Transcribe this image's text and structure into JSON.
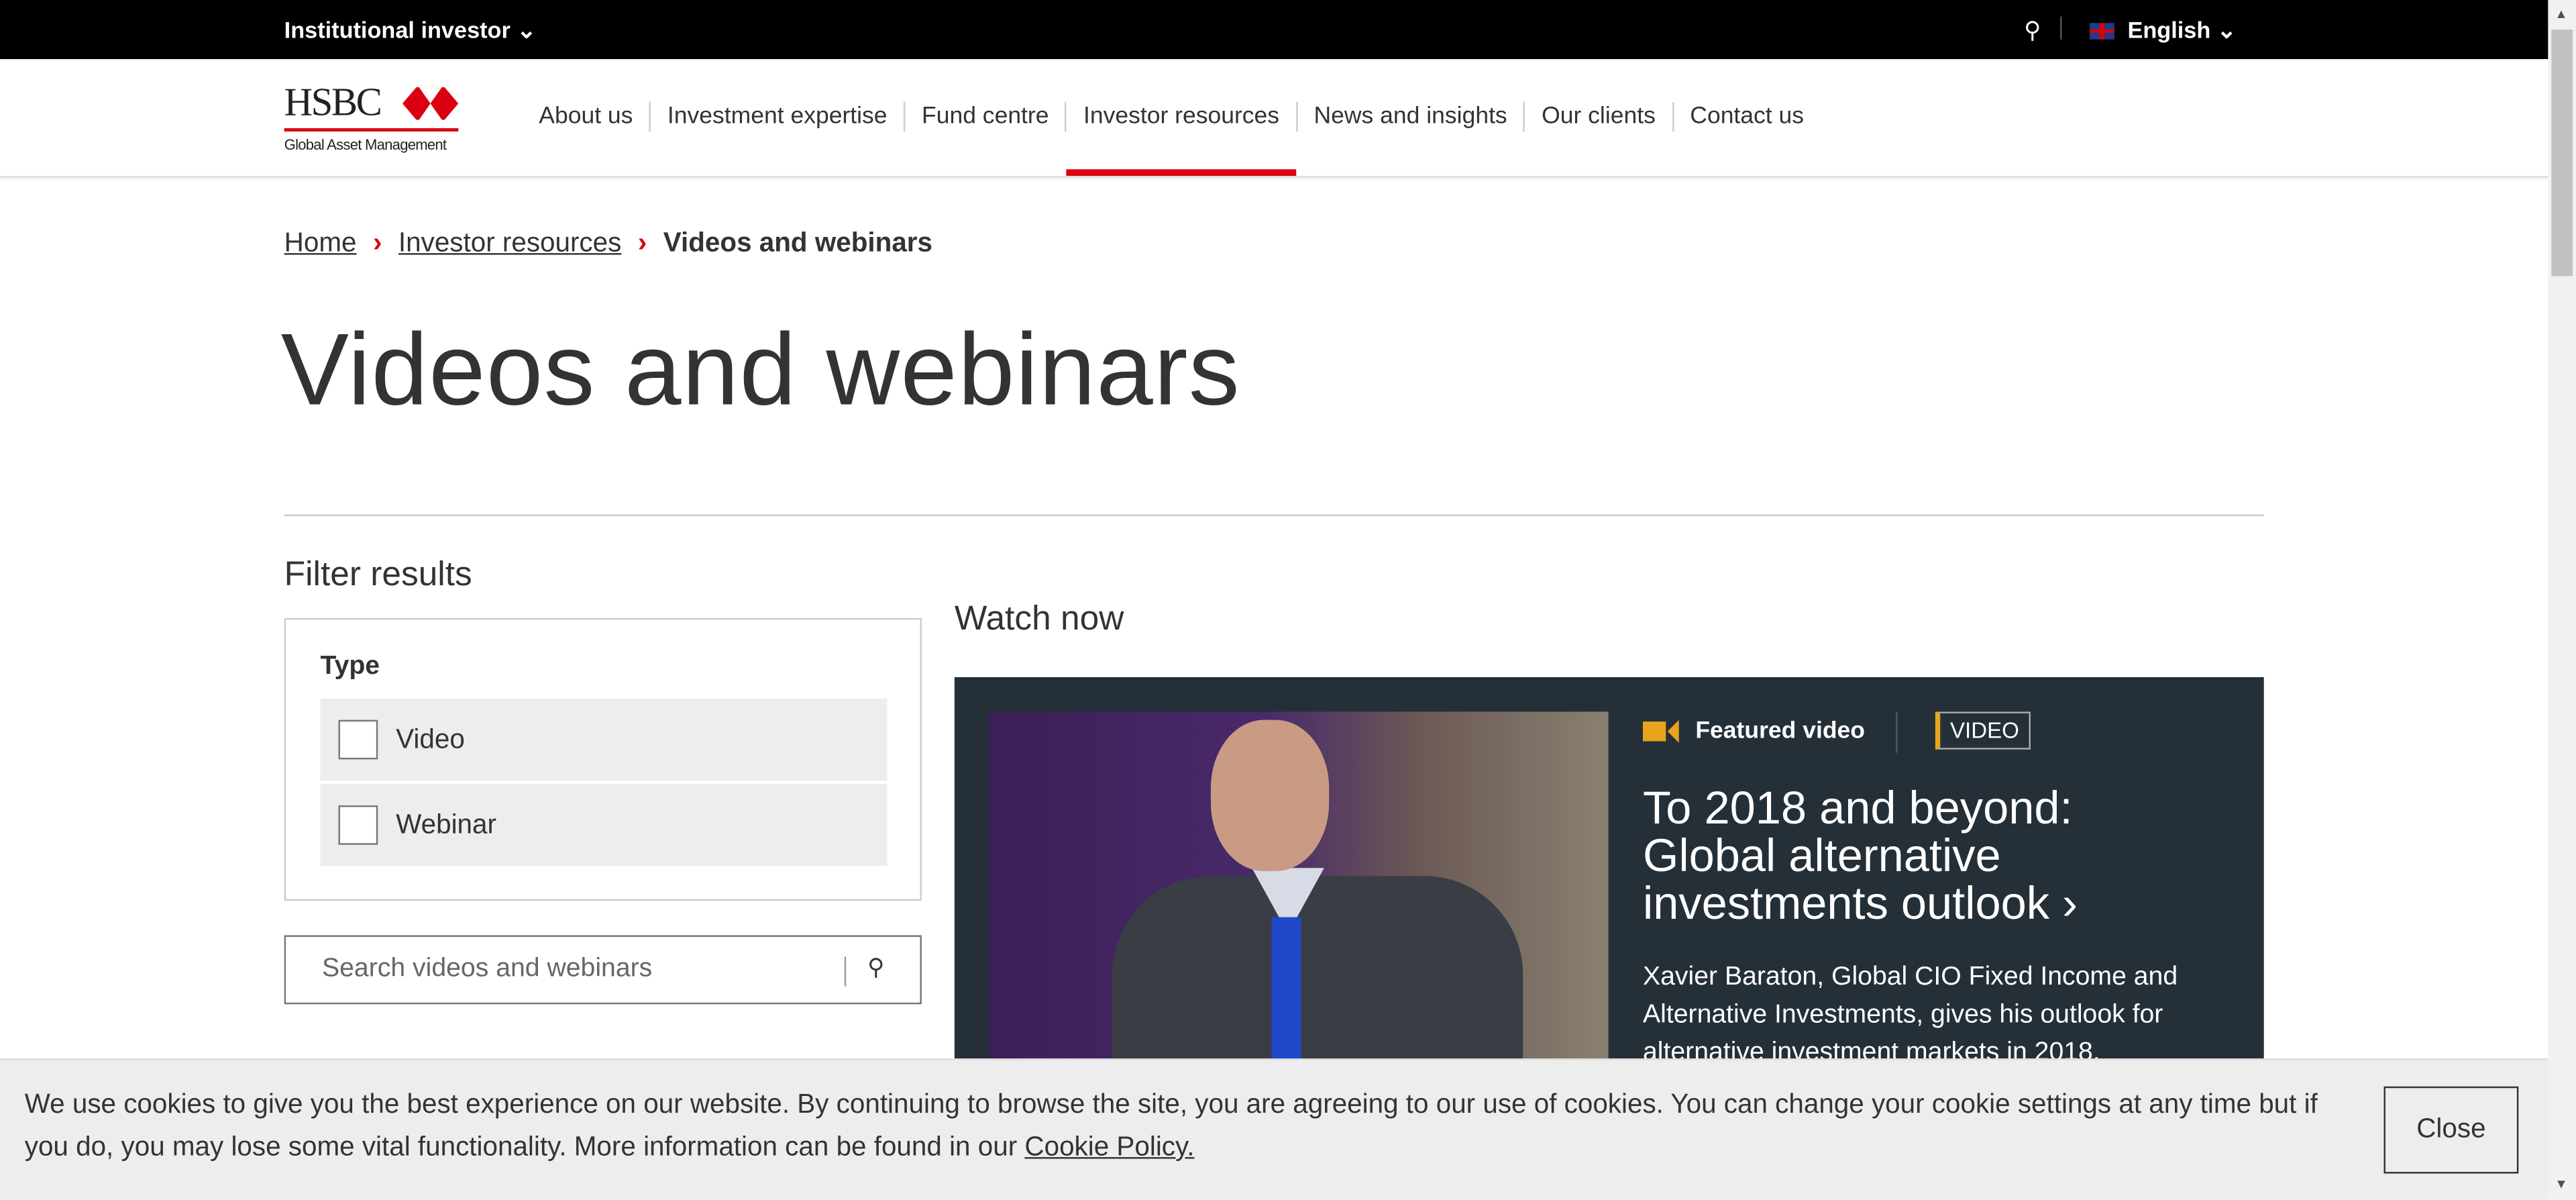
{
  "topbar": {
    "audience": "Institutional investor",
    "chevron": "⌄",
    "search_icon": "⚲",
    "language": "English"
  },
  "logo": {
    "brand": "HSBC",
    "subtitle": "Global Asset Management"
  },
  "nav": [
    "About us",
    "Investment expertise",
    "Fund centre",
    "Investor resources",
    "News and insights",
    "Our clients",
    "Contact us"
  ],
  "nav_active": "Investor resources",
  "breadcrumb": {
    "home": "Home",
    "parent": "Investor resources",
    "current": "Videos and webinars",
    "separator": ">"
  },
  "page_title": "Videos and webinars",
  "filter": {
    "title": "Filter results",
    "group": "Type",
    "options": [
      "Video",
      "Webinar"
    ],
    "search_placeholder": "Search videos and webinars"
  },
  "watch_now": "Watch now",
  "featured": {
    "label": "Featured video",
    "badge": "VIDEO",
    "title": "To 2018 and beyond: Global alternative investments outlook ›",
    "description": "Xavier Baraton, Global CIO Fixed Income and Alternative Investments, gives his outlook for alternative investment markets in 2018."
  },
  "cookie": {
    "text": "We use cookies to give you the best experience on our website. By continuing to browse the site, you are agreeing to our use of cookies. You can change your cookie settings at any time but if you do, you may lose some vital functionality. More information can be found in our ",
    "link": "Cookie Policy.",
    "close": "Close"
  },
  "colors": {
    "brand_red": "#db0011",
    "featured_bg": "#252f38",
    "accent": "#e7a51d"
  }
}
